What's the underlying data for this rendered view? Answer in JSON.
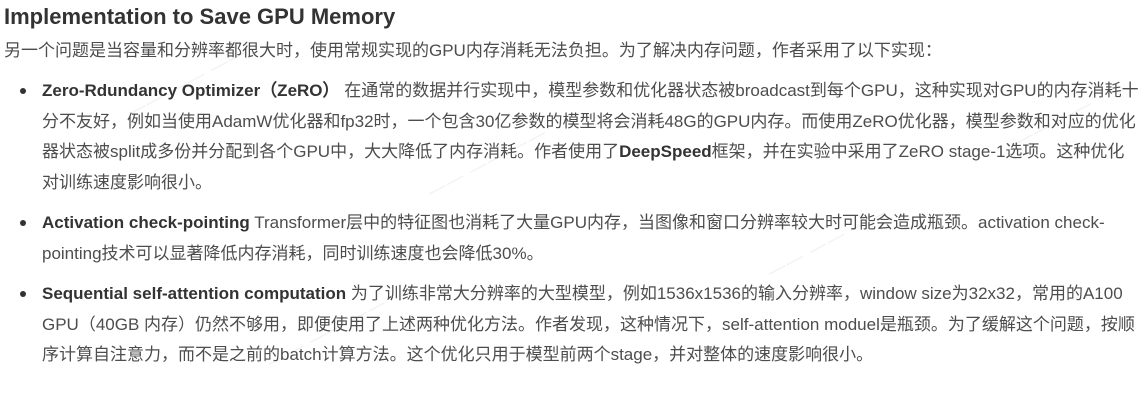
{
  "title": "Implementation to Save GPU Memory",
  "intro": "另一个问题是当容量和分辨率都很大时，使用常规实现的GPU内存消耗无法负担。为了解决内存问题，作者采用了以下实现：",
  "bullets": [
    {
      "term": "Zero-Rdundancy Optimizer（ZeRO）",
      "text_before": " 在通常的数据并行实现中，模型参数和优化器状态被broadcast到每个GPU，这种实现对GPU的内存消耗十分不友好，例如当使用AdamW优化器和fp32时，一个包含30亿参数的模型将会消耗48G的GPU内存。而使用ZeRO优化器，模型参数和对应的优化器状态被split成多份并分配到各个GPU中，大大降低了内存消耗。作者使用了",
      "bold_inline": "DeepSpeed",
      "text_after": "框架，并在实验中采用了ZeRO stage-1选项。这种优化对训练速度影响很小。"
    },
    {
      "term": "Activation check-pointing",
      "text": " Transformer层中的特征图也消耗了大量GPU内存，当图像和窗口分辨率较大时可能会造成瓶颈。activation check-pointing技术可以显著降低内存消耗，同时训练速度也会降低30%。"
    },
    {
      "term": "Sequential self-attention computation",
      "text": " 为了训练非常大分辨率的大型模型，例如1536x1536的输入分辨率，window size为32x32，常用的A100 GPU（40GB 内存）仍然不够用，即便使用了上述两种优化方法。作者发现，这种情况下，self-attention moduel是瓶颈。为了缓解这个问题，按顺序计算自注意力，而不是之前的batch计算方法。这个优化只用于模型前两个stage，并对整体的速度影响很小。"
    }
  ],
  "colors": {
    "heading": "#333333",
    "body_text": "#4d4d4d",
    "background": "#ffffff"
  }
}
